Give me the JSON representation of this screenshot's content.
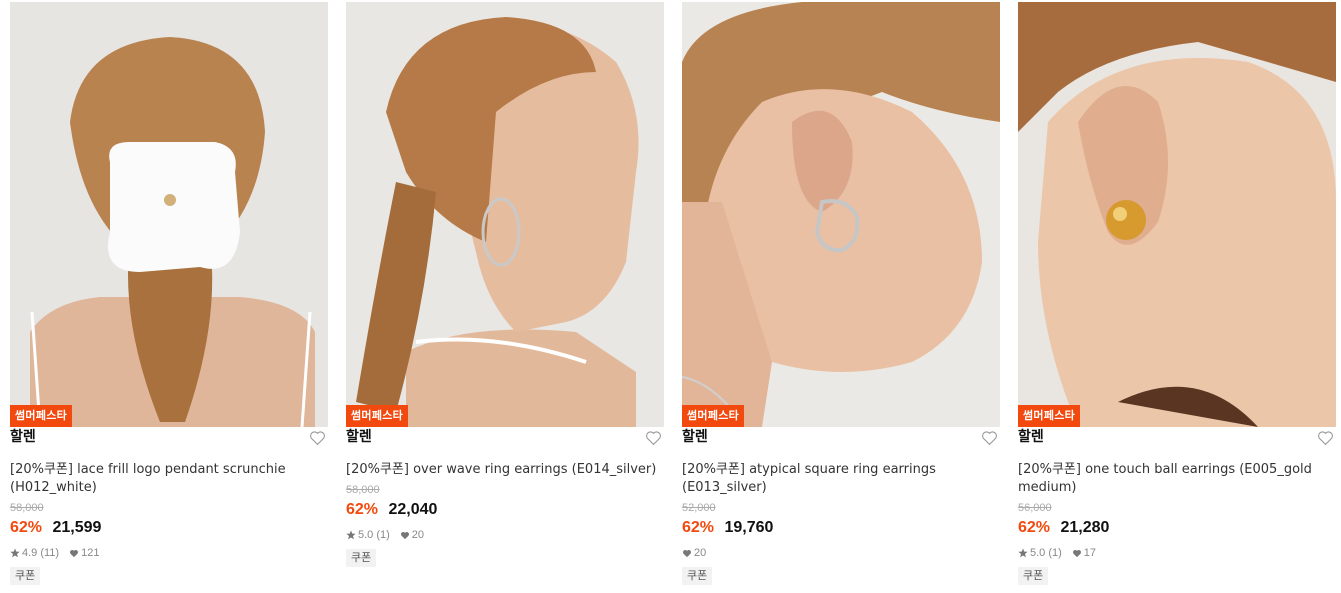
{
  "products": [
    {
      "badge": "썸머페스타",
      "brand": "할렌",
      "name": "[20%쿠폰] lace frill logo pendant scrunchie (H012_white)",
      "original_price": "58,000",
      "discount": "62%",
      "price": "21,599",
      "rating": "4.9 (11)",
      "likes": "121",
      "coupon": "쿠폰"
    },
    {
      "badge": "썸머페스타",
      "brand": "할렌",
      "name": "[20%쿠폰] over wave ring earrings (E014_silver)",
      "original_price": "58,000",
      "discount": "62%",
      "price": "22,040",
      "rating": "5.0 (1)",
      "likes": "20",
      "coupon": "쿠폰"
    },
    {
      "badge": "썸머페스타",
      "brand": "할렌",
      "name": "[20%쿠폰] atypical square ring earrings (E013_silver)",
      "original_price": "52,000",
      "discount": "62%",
      "price": "19,760",
      "rating": "",
      "likes": "20",
      "coupon": "쿠폰"
    },
    {
      "badge": "썸머페스타",
      "brand": "할렌",
      "name": "[20%쿠폰] one touch ball earrings (E005_gold medium)",
      "original_price": "56,000",
      "discount": "62%",
      "price": "21,280",
      "rating": "5.0 (1)",
      "likes": "17",
      "coupon": "쿠폰"
    }
  ],
  "colors": {
    "accent": "#f24a0e",
    "strike": "#aaaaaa",
    "meta": "#888888"
  },
  "icons": {
    "wishlist": "heart-outline-icon",
    "rating": "star-icon",
    "likes": "heart-filled-icon"
  }
}
